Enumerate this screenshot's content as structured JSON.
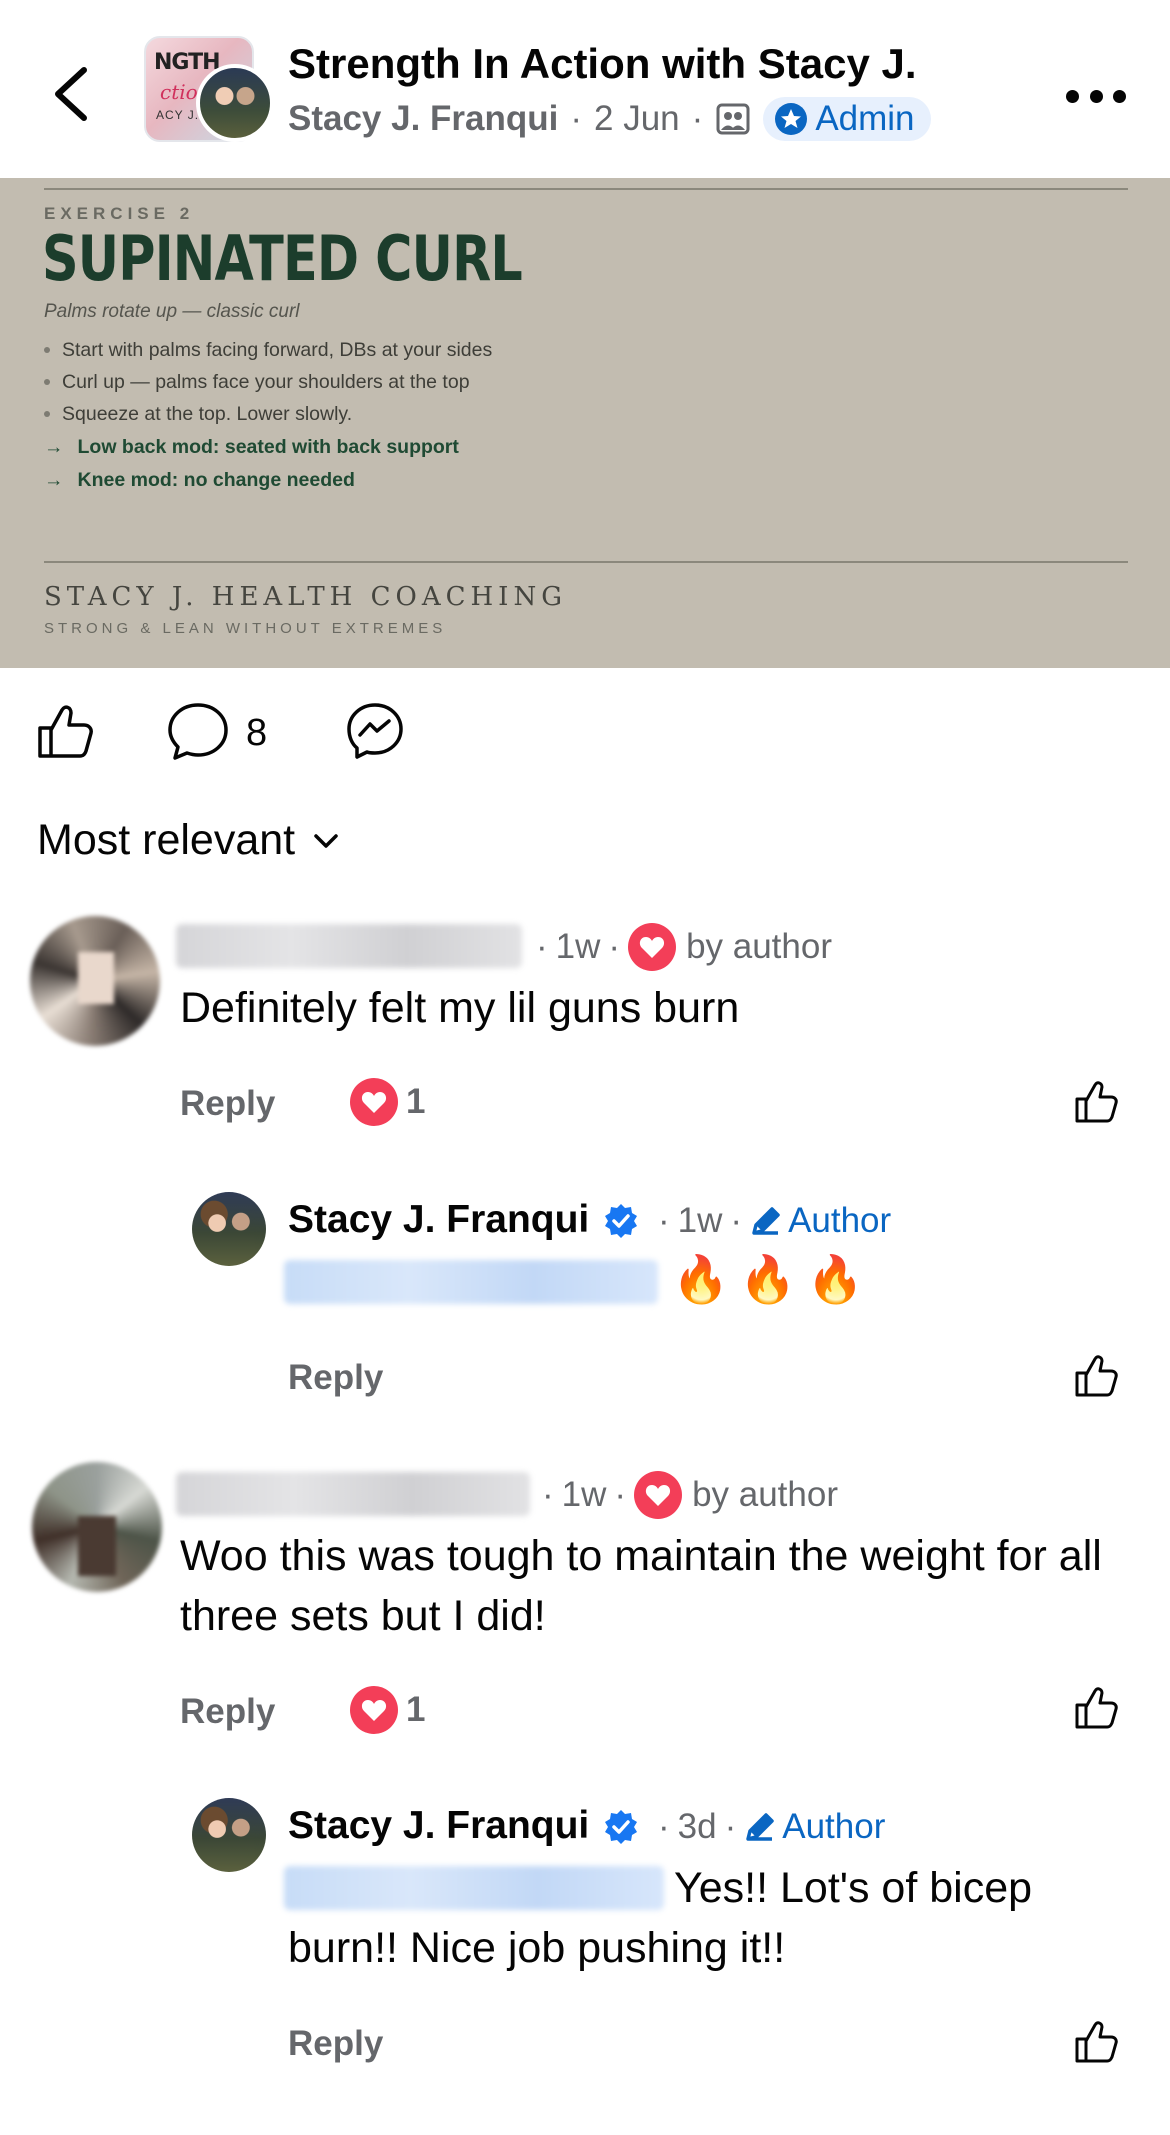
{
  "header": {
    "title": "Strength In Action with Stacy J.",
    "author": "Stacy J. Franqui",
    "date": "2 Jun",
    "admin_label": "Admin",
    "thumb_text_line1": "NGTH",
    "thumb_text_line2": "ction",
    "thumb_text_line3": "ACY J."
  },
  "post_image": {
    "kicker": "EXERCISE 2",
    "heading": "SUPINATED CURL",
    "subtitle": "Palms rotate up — classic curl",
    "steps": [
      "Start with palms facing forward, DBs at your sides",
      "Curl up — palms face your shoulders at the top",
      "Squeeze at the top. Lower slowly."
    ],
    "mods": [
      "Low back mod: seated with back support",
      "Knee mod: no change needed"
    ],
    "brand": "STACY J. HEALTH COACHING",
    "tagline": "STRONG & LEAN WITHOUT EXTREMES"
  },
  "actions": {
    "comment_count": "8"
  },
  "sort": {
    "label": "Most relevant"
  },
  "comments": [
    {
      "time": "1w",
      "by_author": "by author",
      "text": "Definitely felt my lil guns burn",
      "reply_label": "Reply",
      "reaction_count": "1",
      "reply": {
        "name": "Stacy J. Franqui",
        "time": "1w",
        "tag": "Author",
        "text": "🔥🔥🔥",
        "reply_label": "Reply"
      }
    },
    {
      "time": "1w",
      "by_author": "by author",
      "text": "Woo this was tough to maintain the weight for all three sets but I did!",
      "reply_label": "Reply",
      "reaction_count": "1",
      "reply": {
        "name": "Stacy J. Franqui",
        "time": "3d",
        "tag": "Author",
        "text": "Yes!! Lot's of bicep burn!! Nice job pushing it!!",
        "reply_label": "Reply"
      }
    }
  ],
  "icons": {
    "back": "chevron-left-icon",
    "more": "more-horizontal-icon",
    "members": "members-icon",
    "admin": "admin-star-icon",
    "like": "thumbs-up-icon",
    "comment": "comment-bubble-icon",
    "share": "messenger-icon",
    "heart": "heart-icon",
    "verified": "verified-badge-icon",
    "author": "pencil-icon"
  },
  "colors": {
    "accent": "#0a66c2",
    "heart": "#f33e58",
    "verified": "#1877f2",
    "post_bg": "#c2bcb0",
    "heading_green": "#1c3d2c"
  }
}
